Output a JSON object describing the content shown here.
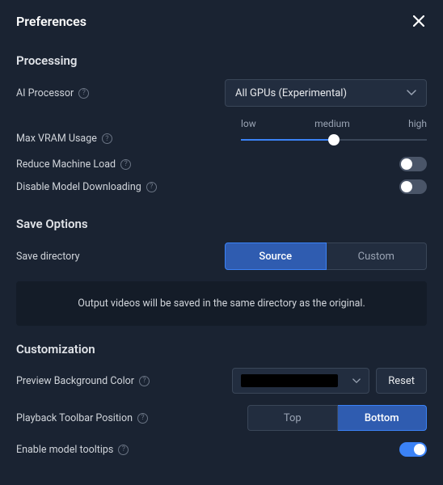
{
  "window": {
    "title": "Preferences"
  },
  "sections": {
    "processing": {
      "title": "Processing",
      "ai_processor": {
        "label": "AI Processor",
        "value": "All GPUs (Experimental)"
      },
      "max_vram": {
        "label": "Max VRAM Usage",
        "low": "low",
        "medium": "medium",
        "high": "high",
        "value_percent": 50
      },
      "reduce_load": {
        "label": "Reduce Machine Load",
        "value": false
      },
      "disable_download": {
        "label": "Disable Model Downloading",
        "value": false
      }
    },
    "save": {
      "title": "Save Options",
      "directory": {
        "label": "Save directory",
        "options": {
          "source": "Source",
          "custom": "Custom"
        },
        "selected": "source"
      },
      "info": "Output videos will be saved in the same directory as the original."
    },
    "customization": {
      "title": "Customization",
      "bg_color": {
        "label": "Preview Background Color",
        "value": "#000000",
        "reset": "Reset"
      },
      "toolbar_position": {
        "label": "Playback Toolbar Position",
        "options": {
          "top": "Top",
          "bottom": "Bottom"
        },
        "selected": "bottom"
      },
      "tooltips": {
        "label": "Enable model tooltips",
        "value": true
      }
    }
  }
}
